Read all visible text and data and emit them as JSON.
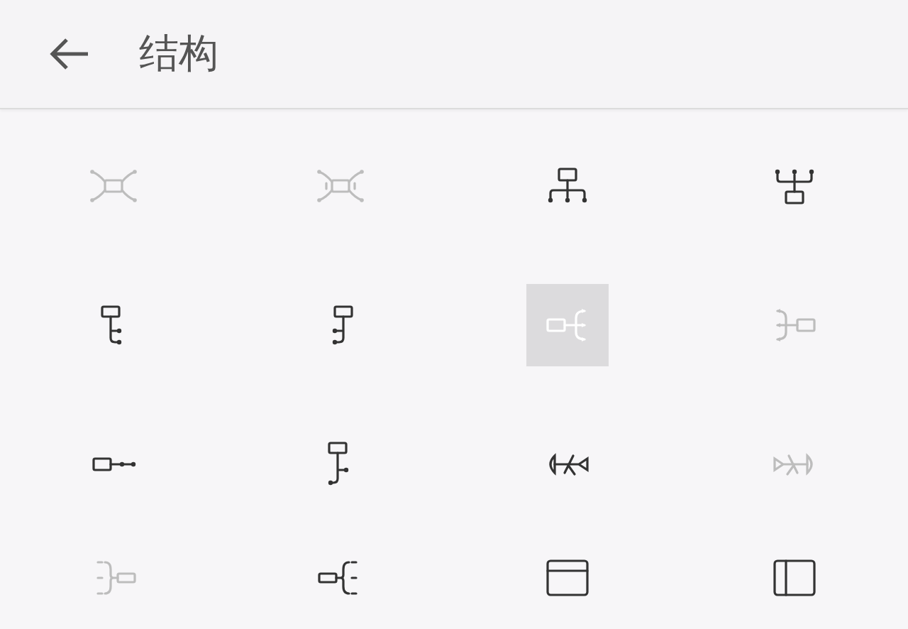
{
  "header": {
    "title": "结构"
  },
  "items": [
    {
      "kind": "mindmap",
      "selected": false,
      "disabled": true
    },
    {
      "kind": "mindmap-numbered",
      "selected": false,
      "disabled": true
    },
    {
      "kind": "org-down",
      "selected": false,
      "disabled": false
    },
    {
      "kind": "org-up",
      "selected": false,
      "disabled": false
    },
    {
      "kind": "tree-right",
      "selected": false,
      "disabled": false
    },
    {
      "kind": "tree-left",
      "selected": false,
      "disabled": false
    },
    {
      "kind": "logic-right",
      "selected": true,
      "disabled": false
    },
    {
      "kind": "logic-left",
      "selected": false,
      "disabled": true
    },
    {
      "kind": "timeline",
      "selected": false,
      "disabled": false
    },
    {
      "kind": "tree-mixed",
      "selected": false,
      "disabled": false
    },
    {
      "kind": "fishbone-left",
      "selected": false,
      "disabled": false
    },
    {
      "kind": "fishbone-right",
      "selected": false,
      "disabled": true
    },
    {
      "kind": "brace-left",
      "selected": false,
      "disabled": true
    },
    {
      "kind": "brace-right",
      "selected": false,
      "disabled": false
    },
    {
      "kind": "frame-top",
      "selected": false,
      "disabled": false
    },
    {
      "kind": "frame-side",
      "selected": false,
      "disabled": false
    }
  ]
}
